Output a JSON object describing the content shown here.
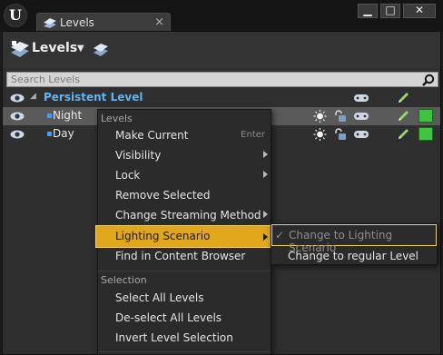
{
  "window": {
    "tab_title": "Levels",
    "tab_close": "×",
    "minimize": "▁",
    "maximize": "□",
    "close": "✕",
    "logo": "U"
  },
  "toolbar": {
    "title": "Levels",
    "caret": "▼"
  },
  "search": {
    "placeholder": "Search Levels"
  },
  "tree": {
    "persistent": "Persistent Level",
    "expand_glyph": "◢",
    "levels": [
      "Night",
      "Day"
    ],
    "swatch_color": "#3fc43f"
  },
  "context_menu": {
    "section_levels": "Levels",
    "make_current": "Make Current",
    "make_current_shortcut": "Enter",
    "visibility": "Visibility",
    "lock": "Lock",
    "remove_selected": "Remove Selected",
    "change_streaming_method": "Change Streaming Method",
    "lighting_scenario": "Lighting Scenario",
    "find_in_content_browser": "Find in Content Browser",
    "section_selection": "Selection",
    "select_all_levels": "Select All Levels",
    "deselect_all_levels": "De-select All Levels",
    "invert_level_selection": "Invert Level Selection"
  },
  "submenu": {
    "check": "✓",
    "change_to_lighting_scenario": "Change to Lighting Scenario",
    "change_to_regular_level": "Change to regular Level"
  },
  "colors": {
    "highlight": "#e0a71c",
    "persistent_text": "#5fb4f2",
    "level_dot": "#3ea0ff"
  }
}
